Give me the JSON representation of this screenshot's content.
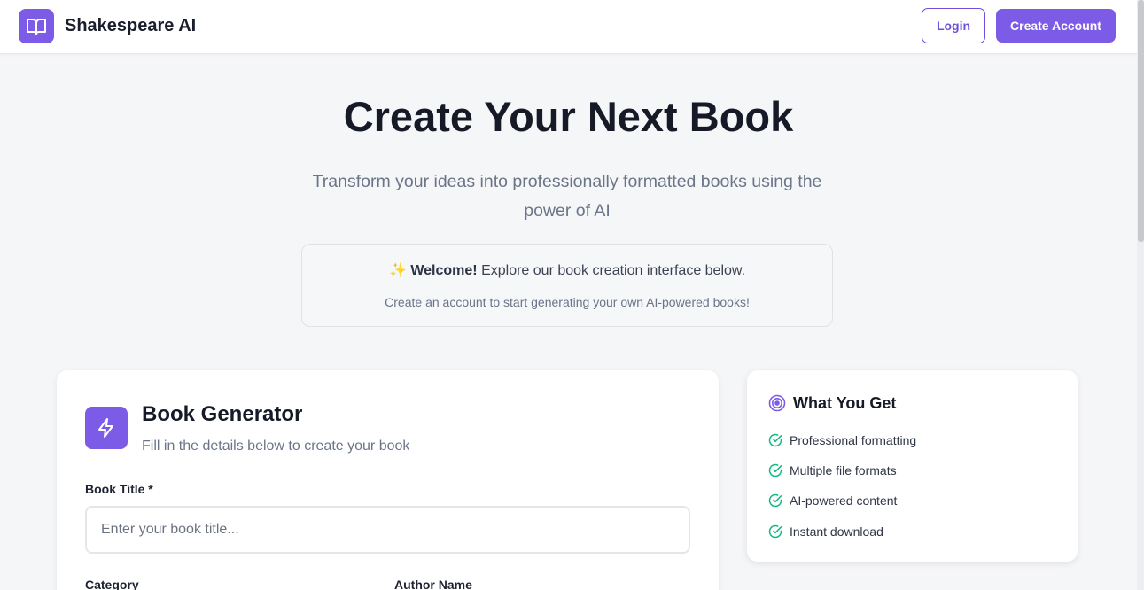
{
  "header": {
    "brand": "Shakespeare AI",
    "login_label": "Login",
    "create_account_label": "Create Account"
  },
  "hero": {
    "title": "Create Your Next Book",
    "subtitle": "Transform your ideas into professionally formatted books using the power of AI"
  },
  "welcome": {
    "emoji": "✨",
    "bold": "Welcome!",
    "text": " Explore our book creation interface below.",
    "note": "Create an account to start generating your own AI-powered books!"
  },
  "generator": {
    "title": "Book Generator",
    "subtitle": "Fill in the details below to create your book",
    "book_title_label": "Book Title *",
    "book_title_placeholder": "Enter your book title...",
    "book_title_value": "",
    "category_label": "Category",
    "author_label": "Author Name"
  },
  "benefits": {
    "title": "What You Get",
    "items": [
      {
        "label": "Professional formatting"
      },
      {
        "label": "Multiple file formats"
      },
      {
        "label": "AI-powered content"
      },
      {
        "label": "Instant download"
      }
    ]
  },
  "colors": {
    "accent": "#7c5ce6",
    "check": "#10b981",
    "page_bg": "#f5f6f8"
  },
  "icons": {
    "logo": "open-book-icon",
    "generator": "lightning-icon",
    "benefits_title": "target-icon",
    "benefit_item": "check-circle-icon"
  }
}
